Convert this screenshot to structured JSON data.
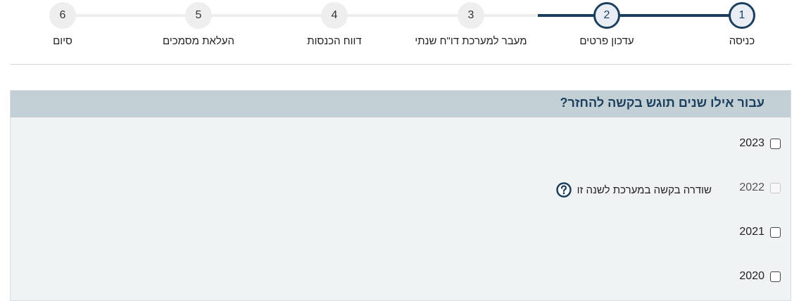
{
  "stepper": {
    "steps": [
      {
        "number": "1",
        "label": "כניסה"
      },
      {
        "number": "2",
        "label": "עדכון פרטים"
      },
      {
        "number": "3",
        "label": "מעבר למערכת דו\"ח שנתי"
      },
      {
        "number": "4",
        "label": "דווח הכנסות"
      },
      {
        "number": "5",
        "label": "העלאת מסמכים"
      },
      {
        "number": "6",
        "label": "סיום"
      }
    ],
    "current_step": 2
  },
  "panel": {
    "question": "עבור אילו שנים תוגש בקשה להחזר?",
    "years": [
      {
        "year": "2023",
        "checked": false,
        "disabled": false
      },
      {
        "year": "2022",
        "checked": false,
        "disabled": true,
        "note": "שודרה בקשה במערכת לשנה זו"
      },
      {
        "year": "2021",
        "checked": false,
        "disabled": false
      },
      {
        "year": "2020",
        "checked": false,
        "disabled": false
      }
    ]
  },
  "colors": {
    "accent": "#1c3f5e",
    "header_bg": "#c2cfd5",
    "panel_bg": "#f0f3f4",
    "step_inactive": "#eeeeee"
  },
  "icons": {
    "help": "question-circle-icon"
  }
}
